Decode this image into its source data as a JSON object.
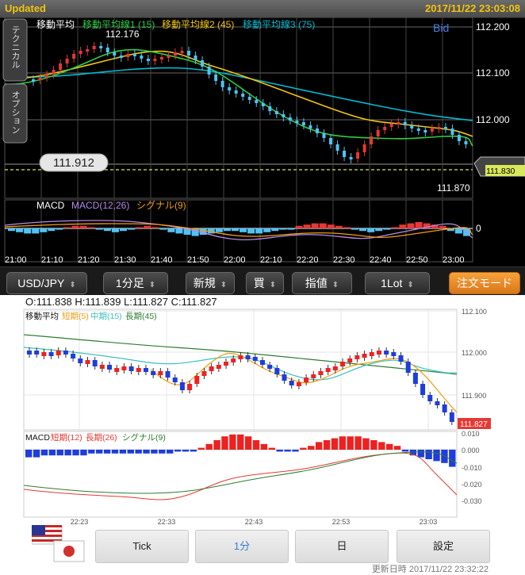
{
  "top": {
    "status": "Updated",
    "timestamp": "2017/11/22 23:03:08",
    "side_tabs": {
      "tech": "テクニカル",
      "option": "オプション"
    },
    "legend": {
      "ma": "移動平均",
      "ma1": "移動平均線1 (15)",
      "ma2": "移動平均線2 (45)",
      "ma3": "移動平均線3 (75)"
    },
    "bid_label": "Bid",
    "y_ticks": [
      "112.200",
      "112.100",
      "112.000"
    ],
    "high_label": "112.176",
    "low_label": "111.870",
    "current_price": "111.912",
    "current_marker": "111.830",
    "macd_legend": {
      "macd": "MACD",
      "params": "MACD(12,26)",
      "signal": "シグナル(9)"
    },
    "macd_zero": "0",
    "x_ticks": [
      "21:00",
      "21:10",
      "21:20",
      "21:30",
      "21:40",
      "21:50",
      "22:00",
      "22:10",
      "22:20",
      "22:30",
      "22:40",
      "22:50",
      "23:00"
    ],
    "colors": {
      "up": "#e53935",
      "down": "#4fc3f7",
      "ma1": "#2ecc40",
      "ma2": "#f1c40f",
      "ma3": "#00bcd4"
    },
    "footer": {
      "pair": "USD/JPY",
      "timeframe": "1分足",
      "new_order": "新規",
      "side": "買",
      "order_type": "指値",
      "lot": "1Lot",
      "order_mode": "注文モード"
    }
  },
  "bottom": {
    "ohlc": "O:111.838 H:111.839 L:111.827 C:111.827",
    "ma_legend": {
      "ma": "移動平均",
      "short": "短期(5)",
      "mid": "中期(15)",
      "long": "長期(45)"
    },
    "y_ticks": [
      "112.100",
      "112.000",
      "111.900"
    ],
    "current_price": "111.827",
    "macd_legend": {
      "macd": "MACD",
      "short": "短期(12)",
      "long": "長期(26)",
      "signal": "シグナル(9)"
    },
    "macd_ticks": [
      "0.010",
      "0.000",
      "-0.010",
      "-0.020",
      "-0.030"
    ],
    "x_ticks": [
      "22:23",
      "22:33",
      "22:43",
      "22:53",
      "23:03"
    ],
    "buttons": {
      "tick": "Tick",
      "minute": "1分",
      "day": "日",
      "settings": "設定"
    },
    "updated_label": "更新日時",
    "updated_time": "2017/11/22 23:32:22",
    "colors": {
      "up": "#f02020",
      "down": "#1e3ddc",
      "short": "#f39c12",
      "mid": "#3cc0c0",
      "long": "#2e7d32"
    }
  }
}
